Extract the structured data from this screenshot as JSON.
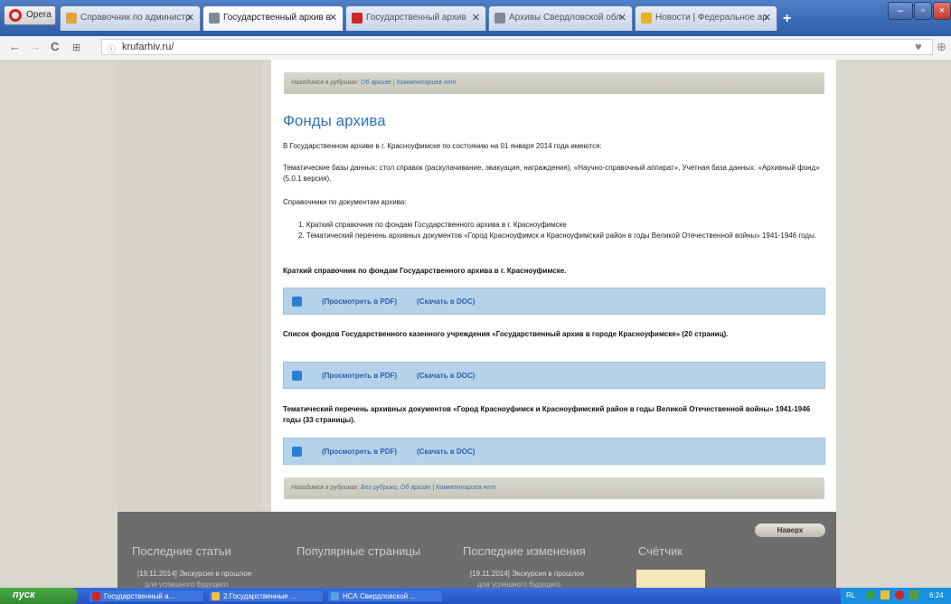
{
  "browser": {
    "menu_label": "Opera",
    "tabs": [
      {
        "label": "Справочник по администр",
        "favicon_color": "#e3a33a"
      },
      {
        "label": "Государственный архив в",
        "favicon_color": "#7f8a99"
      },
      {
        "label": "Государственный архив",
        "favicon_color": "#d0261d"
      },
      {
        "label": "Архивы Свердловской обл",
        "favicon_color": "#7f8a99"
      },
      {
        "label": "Новости | Федеральное ар",
        "favicon_color": "#e6b21f"
      }
    ],
    "new_tab": "+",
    "url": "krufarhiv.ru/",
    "window_buttons": [
      "–",
      "▫",
      "×"
    ]
  },
  "content": {
    "crumbs_top": {
      "prefix": "Находимся в рубриках:",
      "links": [
        "Об архиве",
        "Комментариев нет"
      ]
    },
    "title": "Фонды архива",
    "intro": "В Государственном архиве в г. Красноуфимске по состоянию на 01 января 2014 года имеются:",
    "databases": "Тематические базы данных: стол справок (раскулачивание, эвакуация, награждения), «Научно-справочный аппарат», Учетная база данных: «Архивный фонд» (5.0.1 версия).",
    "guides_label": "Справочники по документам архива:",
    "guides": [
      "1.  Краткий справочник по фондам Государственного архива в г. Красноуфимске",
      "2.  Тематический перечень архивных документов «Город Красноуфимск и Красноуфимский район в годы Великой Отечественной войны» 1941-1946 годы."
    ],
    "sections": [
      {
        "title": "Краткий справочник по фондам Государственного архива в г. Красноуфимске."
      },
      {
        "title": "Список фондов Государственного казенного учреждения «Государственный архив в городе Красноуфимске» (20 страниц)."
      },
      {
        "title": "Тематический перечень архивных документов «Город Красноуфимск и Красноуфимский район в годы Великой Отечественной войны» 1941-1946 годы (33 страницы)."
      }
    ],
    "view_pdf": "(Просмотреть в PDF)",
    "download_doc": "(Скачать в DOC)",
    "crumbs_bottom": {
      "prefix": "Находимся в рубриках:",
      "links": [
        "Без рубрики",
        "Об архиве",
        "Комментариев нет"
      ]
    }
  },
  "footer": {
    "top_button": "Наверх",
    "columns": [
      "Последние статьи",
      "Популярные страницы",
      "Последние изменения",
      "Счётчик"
    ],
    "recent_article": "[19.11.2014] Экскурсия в прошлое",
    "recent_article_sub": "для успешного будущего",
    "recent_change": "[19.11.2014] Экскурсия в прошлое",
    "recent_change_sub": "для успешного будущего"
  },
  "taskbar": {
    "start": "пуск",
    "tasks": [
      {
        "label": "Государственный а...",
        "icon_color": "#d0261d"
      },
      {
        "label": "2.Государственные ...",
        "icon_color": "#f0c040"
      },
      {
        "label": "НСА Свердловской ...",
        "icon_color": "#5aa0e8"
      }
    ],
    "lang": "RL",
    "clock": "6:24"
  }
}
